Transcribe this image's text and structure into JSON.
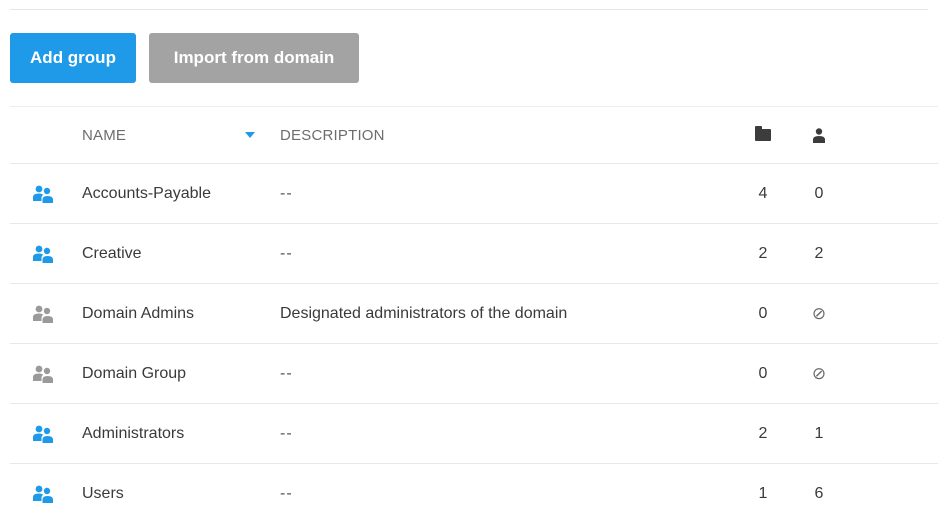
{
  "toolbar": {
    "add_group_label": "Add group",
    "import_label": "Import from domain"
  },
  "table": {
    "headers": {
      "name": "NAME",
      "description": "DESCRIPTION",
      "folders_icon": "folder-icon",
      "members_icon": "user-icon"
    },
    "sort": {
      "column": "name",
      "direction": "descending",
      "color": "#1e9ae8"
    },
    "rows": [
      {
        "icon": "group-icon",
        "icon_color": "#1e9ae8",
        "name": "Accounts-Payable",
        "description": "--",
        "folders": "4",
        "members": "0"
      },
      {
        "icon": "group-icon",
        "icon_color": "#1e9ae8",
        "name": "Creative",
        "description": "--",
        "folders": "2",
        "members": "2"
      },
      {
        "icon": "group-icon",
        "icon_color": "#9a9a9a",
        "name": "Domain Admins",
        "description": "Designated administrators of the domain",
        "folders": "0",
        "members": "⊘"
      },
      {
        "icon": "group-icon",
        "icon_color": "#9a9a9a",
        "name": "Domain Group",
        "description": "--",
        "folders": "0",
        "members": "⊘"
      },
      {
        "icon": "group-icon",
        "icon_color": "#1e9ae8",
        "name": "Administrators",
        "description": "--",
        "folders": "2",
        "members": "1"
      },
      {
        "icon": "group-icon",
        "icon_color": "#1e9ae8",
        "name": "Users",
        "description": "--",
        "folders": "1",
        "members": "6"
      }
    ]
  }
}
